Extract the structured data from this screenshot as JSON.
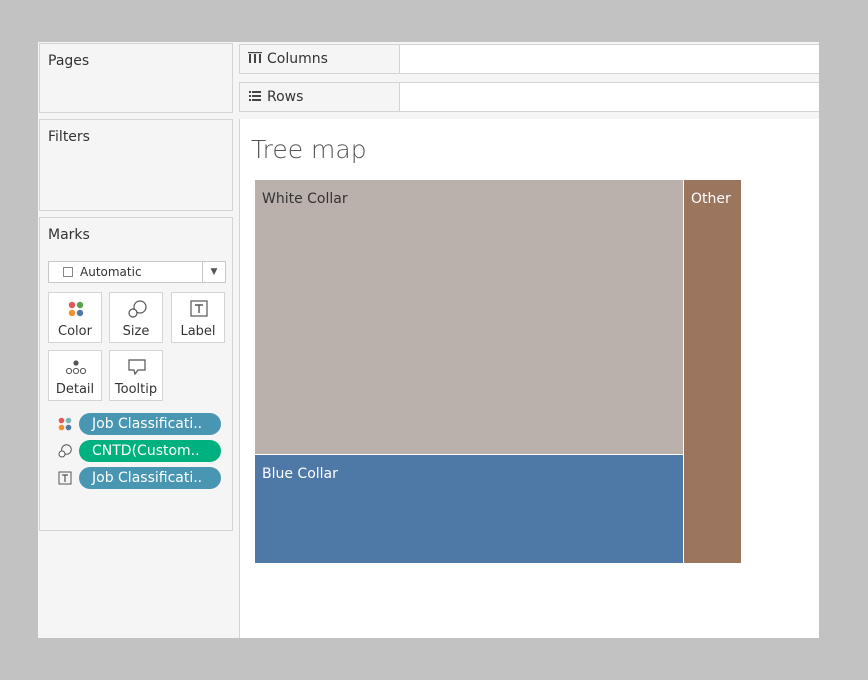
{
  "pages": {
    "title": "Pages"
  },
  "filters": {
    "title": "Filters"
  },
  "marks": {
    "title": "Marks",
    "mark_type": "Automatic",
    "cards": {
      "color": "Color",
      "size": "Size",
      "label": "Label",
      "detail": "Detail",
      "tooltip": "Tooltip"
    },
    "pills": [
      {
        "text": "Job Classificati..",
        "color": "#4996b2",
        "icon": "color-icon"
      },
      {
        "text": "CNTD(Custom..",
        "color": "#00b180",
        "icon": "size-icon"
      },
      {
        "text": "Job Classificati..",
        "color": "#4996b2",
        "icon": "label-icon"
      }
    ]
  },
  "shelves": {
    "columns": "Columns",
    "rows": "Rows"
  },
  "viz": {
    "title": "Tree map"
  },
  "chart_data": {
    "type": "treemap",
    "title": "Tree map",
    "items": [
      {
        "label": "White Collar",
        "color": "#bab0ac",
        "text_color": "#333333",
        "share": 0.63
      },
      {
        "label": "Blue Collar",
        "color": "#4e79a7",
        "text_color": "#ffffff",
        "share": 0.25
      },
      {
        "label": "Other",
        "color": "#9c755f",
        "text_color": "#ffffff",
        "share": 0.12
      }
    ]
  }
}
